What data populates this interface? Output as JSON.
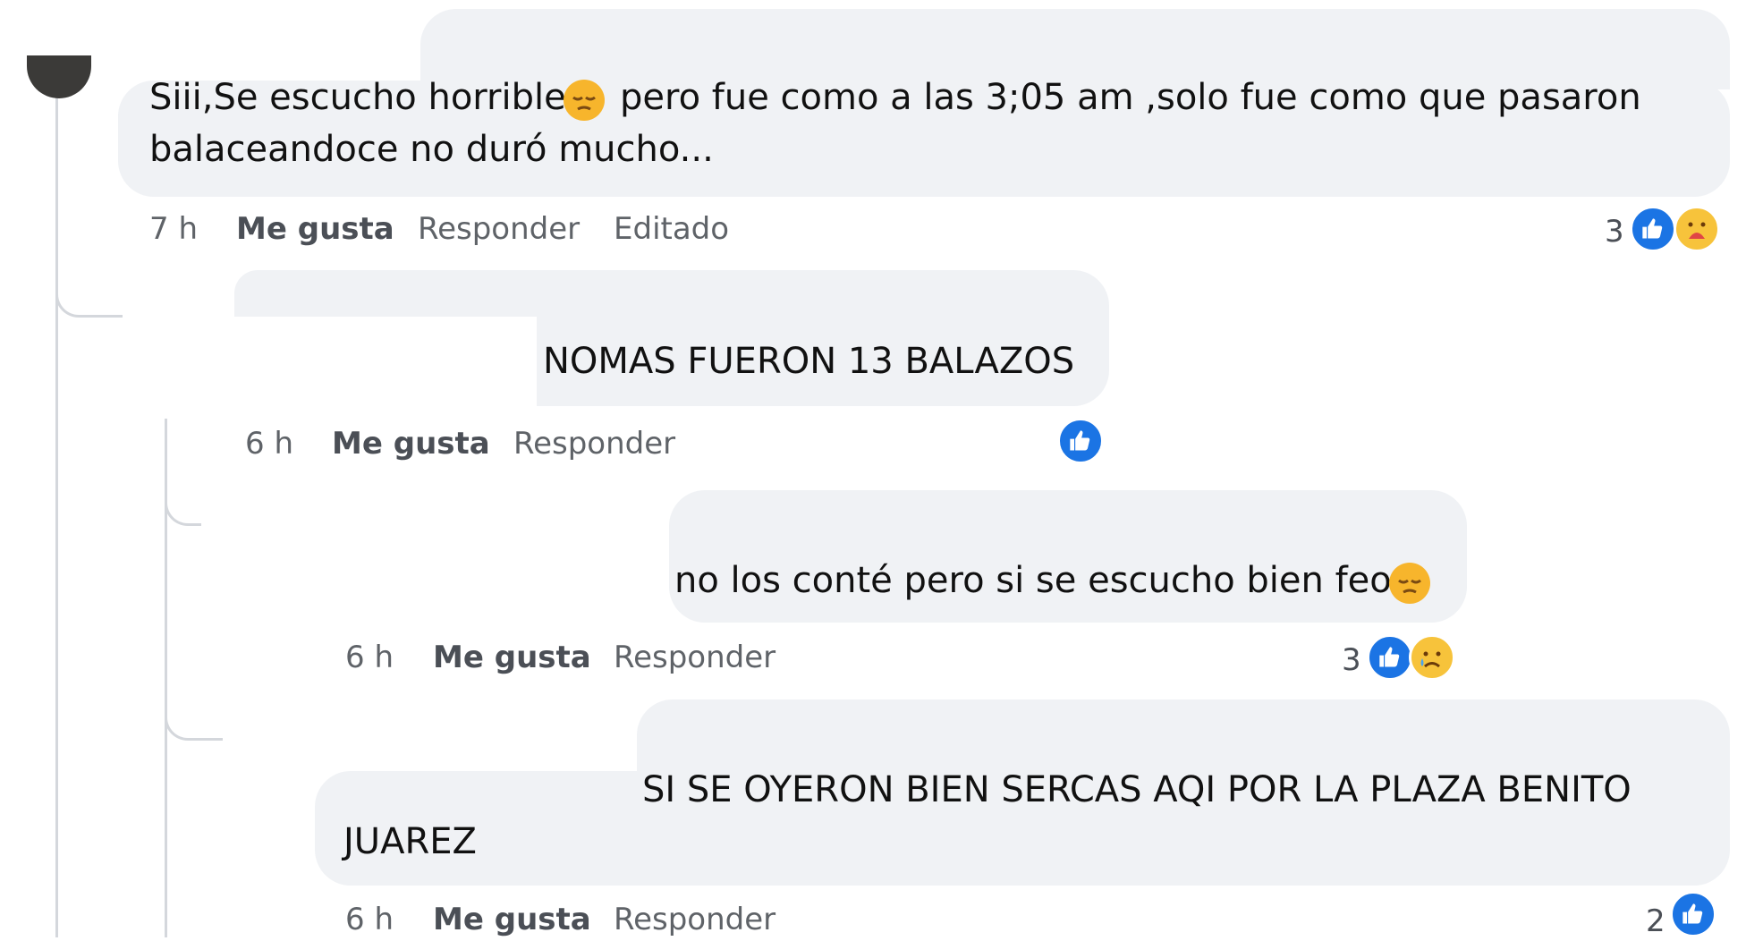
{
  "comments": [
    {
      "text_line1": "Siii,Se escucho horrible",
      "text_line1b": "pero fue como a las 3;05 am ,solo fue como que pasaron",
      "text_line2": "balaceandoce no duró mucho...",
      "time": "7 h",
      "like_label": "Me gusta",
      "reply_label": "Responder",
      "edited_label": "Editado",
      "reaction_count": "3",
      "reactions": [
        "like-icon",
        "care-emoji-icon"
      ]
    },
    {
      "text": "NOMAS FUERON 13 BALAZOS",
      "time": "6 h",
      "like_label": "Me gusta",
      "reply_label": "Responder",
      "reactions": [
        "like-icon"
      ]
    },
    {
      "text": "no los conté pero si se escucho bien feo",
      "time": "6 h",
      "like_label": "Me gusta",
      "reply_label": "Responder",
      "reaction_count": "3",
      "reactions": [
        "like-icon",
        "sad-emoji-icon"
      ]
    },
    {
      "text_line1": "SI SE OYERON BIEN SERCAS AQI POR LA PLAZA BENITO",
      "text_line2": "JUAREZ",
      "time": "6 h",
      "like_label": "Me gusta",
      "reply_label": "Responder",
      "reaction_count": "2",
      "reactions": [
        "like-icon"
      ]
    }
  ],
  "colors": {
    "bubble": "#f0f2f5",
    "like_blue": "#1b74e4",
    "thread_line": "#d4d7dc"
  }
}
